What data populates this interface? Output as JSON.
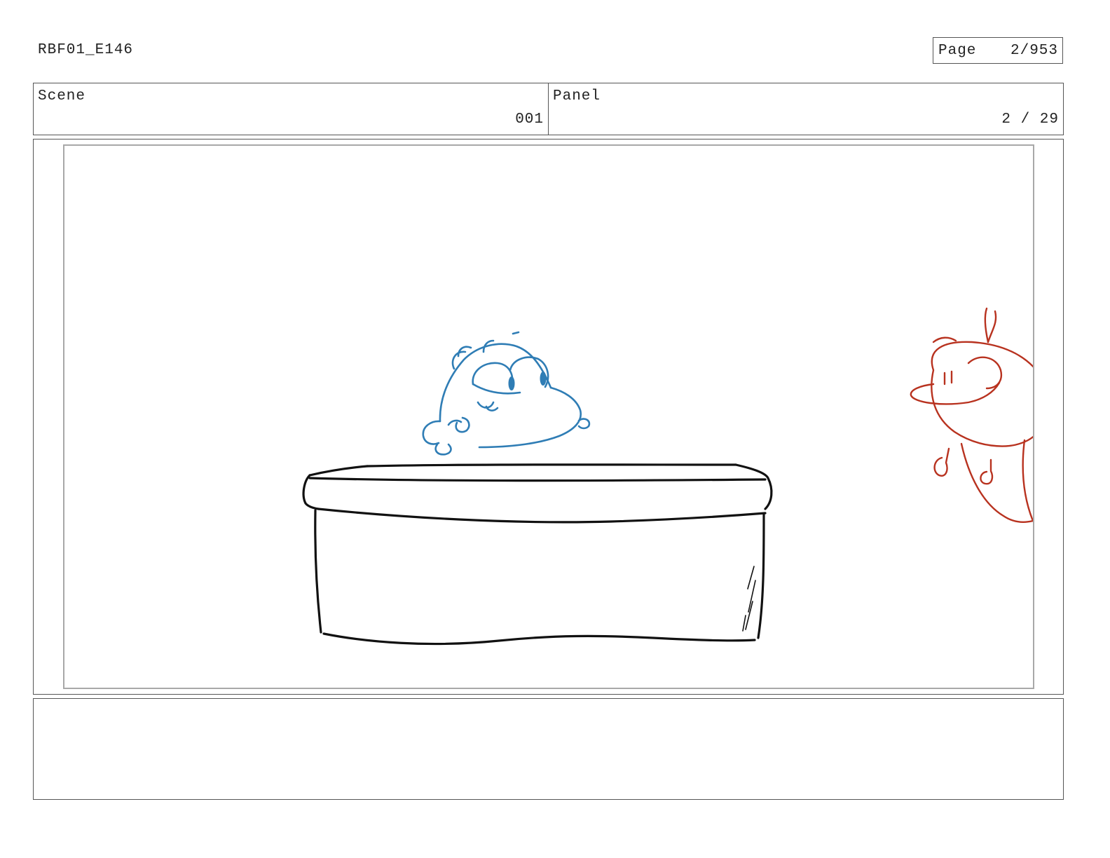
{
  "header": {
    "document_id": "RBF01_E146",
    "page_label": "Page",
    "page_value": "2/953"
  },
  "info": {
    "scene_label": "Scene",
    "scene_value": "001",
    "panel_label": "Panel",
    "panel_value": "2 / 29"
  },
  "drawing": {
    "description_icons": [
      "blue-character-sketch",
      "red-character-sketch",
      "counter-box-sketch"
    ],
    "colors": {
      "blue_character": "#2f7db5",
      "red_character": "#b8321f",
      "counter": "#111111"
    }
  },
  "notes": {
    "text": ""
  }
}
